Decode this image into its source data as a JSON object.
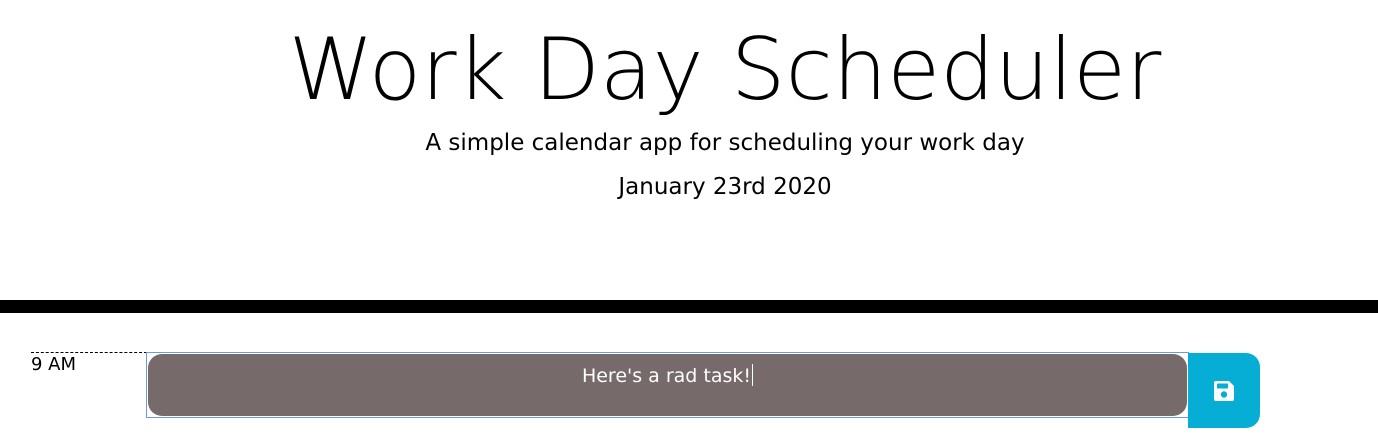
{
  "header": {
    "title": "Work Day Scheduler",
    "subtitle": "A simple calendar app for scheduling your work day",
    "current_date": "January 23rd 2020"
  },
  "time_blocks": [
    {
      "hour_label": "9 AM",
      "description": "Here's a rad task!",
      "save_icon": "save-icon",
      "status_color": "#776a6a"
    }
  ],
  "colors": {
    "divider": "#000000",
    "save_button": "#06aed5",
    "focus_border": "#6f97e8"
  }
}
